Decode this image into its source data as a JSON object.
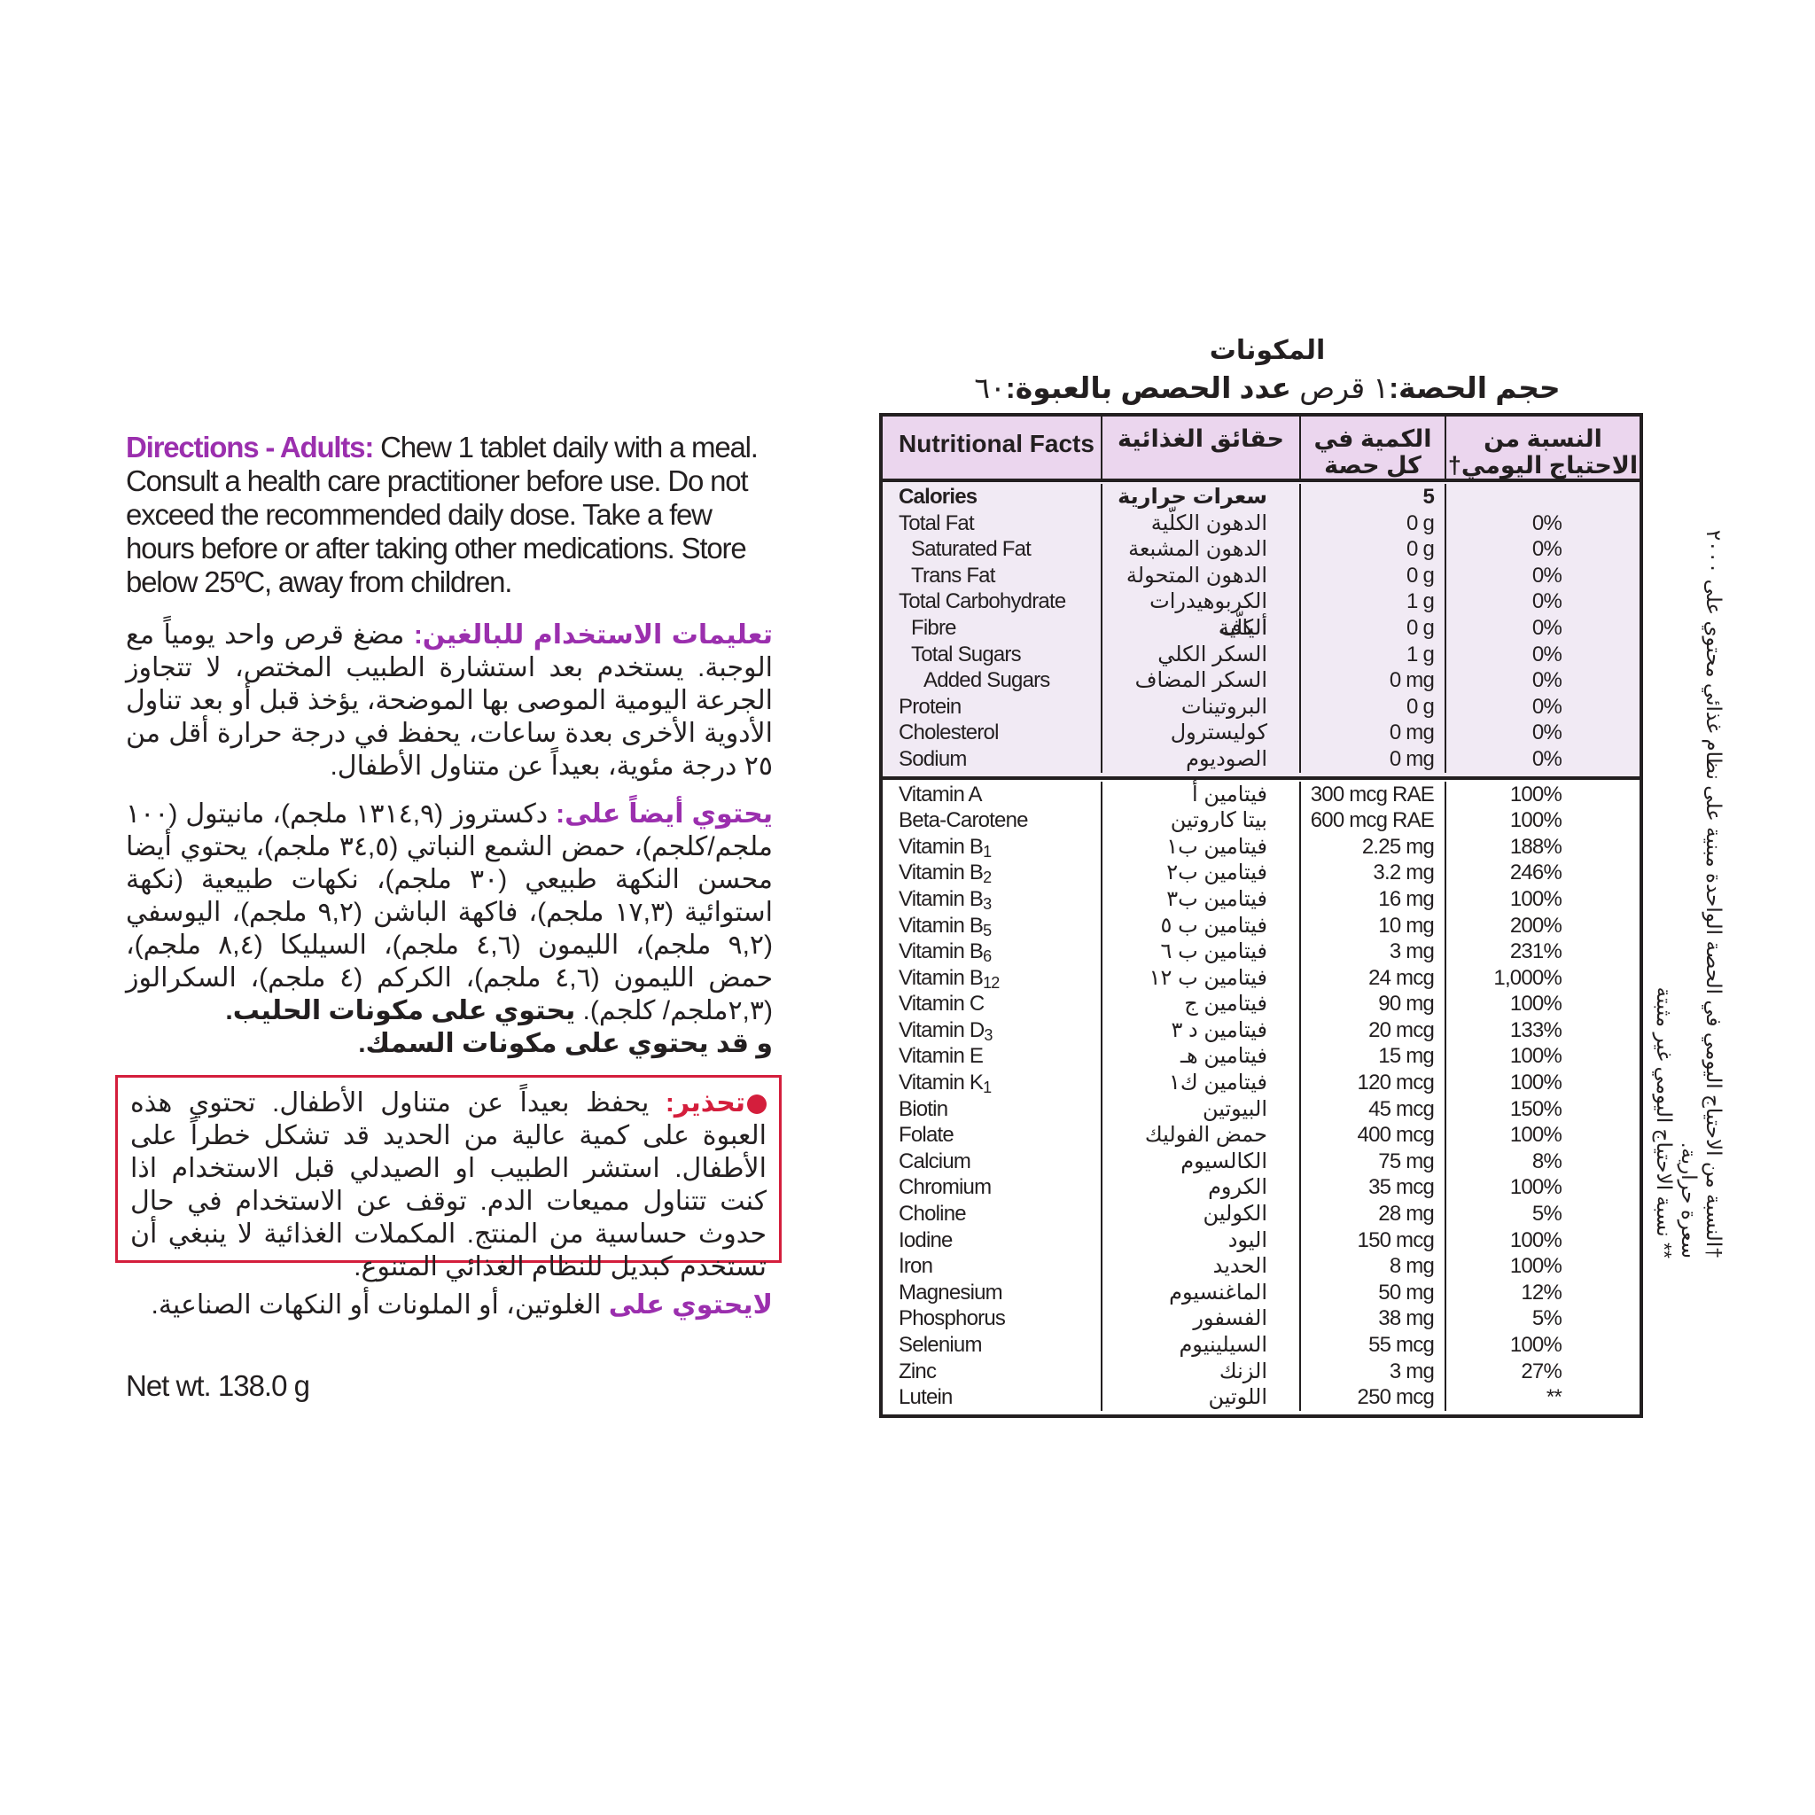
{
  "left": {
    "directions_en": {
      "label": "Directions - Adults:",
      "text": " Chew 1 tablet daily with a meal. Consult a health care practitioner before use. Do not exceed the recommended daily dose. Take a few hours before or after taking other medications. Store below 25ºC, away from children."
    },
    "directions_ar": {
      "label": "تعليمات الاستخدام للبالغين:",
      "text": " مضغ قرص واحد يومياً مع الوجبة. يستخدم بعد استشارة الطبيب المختص، لا تتجاوز الجرعة اليومية الموصى بها الموضحة، يؤخذ قبل أو بعد تناول الأدوية الأخرى بعدة ساعات، يحفظ في درجة حرارة أقل من ٢٥ درجة مئوية، بعيداً عن متناول الأطفال."
    },
    "also_contains_ar": {
      "label": "يحتوي أيضاً على:",
      "text": " دكستروز (١٣١٤,٩ ملجم)، مانيتول (١٠٠ ملجم/كلجم)، حمض الشمع النباتي (٣٤,٥ ملجم)، يحتوي أيضا محسن النكهة طبيعي (٣٠ ملجم)، نكهات طبيعية (نكهة استوائية (١٧,٣ ملجم)، فاكهة الباشن (٩,٢ ملجم)، اليوسفي (٩,٢ ملجم)، الليمون (٤,٦ ملجم)، السيليكا (٨,٤ ملجم)، حمض الليمون (٤,٦ ملجم)، الكركم (٤ ملجم)، السكرالوز (٢,٣ملجم/ كلجم). ",
      "milk": "يحتوي على مكونات الحليب.",
      "fish": "و قد يحتوي على مكونات السمك."
    },
    "warning_ar": {
      "icon": "stop-dot-icon",
      "label": "تحذير:",
      "text": " يحفظ بعيداً عن متناول الأطفال. تحتوي هذه العبوة على كمية عالية من الحديد قد تشكل خطراً على الأطفال. استشر الطبيب او الصيدلي قبل الاستخدام اذا كنت تتناول مميعات الدم. توقف عن الاستخدام في حال حدوث حساسية من المنتج. المكملات الغذائية لا ينبغي أن تستخدم كبديل للنظام الغذائي المتنوع."
    },
    "free_from_ar": {
      "label": "لايحتوي على",
      "text": " الغلوتين، أو الملونات أو النكهات الصناعية."
    },
    "net_wt": "Net wt. 138.0 g"
  },
  "colors": {
    "accent_purple": "#9b2fae",
    "warning_red": "#d41e3c",
    "header_bg": "#ebd6ee",
    "macro_bg": "#f1eaf4"
  },
  "titles": {
    "ingredients": "المكونات",
    "serving_size_label": "حجم الحصة:",
    "serving_size_value": "١ قرص",
    "servings_label": " عدد الحصص بالعبوة:",
    "servings_value": "٦٠"
  },
  "table": {
    "headers": {
      "en": "Nutritional Facts",
      "ar": "حقائق الغذائية",
      "amount": "الكمية في كل حصة",
      "dv": "النسبة من الاحتياج اليومي†"
    },
    "macros": [
      {
        "en": "Calories",
        "ar": "سعرات حرارية",
        "amount": "5",
        "dv": "",
        "bold": true,
        "indent": 0
      },
      {
        "en": "Total Fat",
        "ar": "الدهون الكلّية",
        "amount": "0 g",
        "dv": "0%",
        "indent": 0
      },
      {
        "en": "Saturated Fat",
        "ar": "الدهون المشبعة",
        "amount": "0 g",
        "dv": "0%",
        "indent": 1
      },
      {
        "en": "Trans Fat",
        "ar": "الدهون المتحولة",
        "amount": "0 g",
        "dv": "0%",
        "indent": 1
      },
      {
        "en": "Total Carbohydrate",
        "ar": "الكربوهيدرات الكلّية",
        "amount": "1 g",
        "dv": "0%",
        "indent": 0
      },
      {
        "en": "Fibre",
        "ar": "ألياف",
        "amount": "0 g",
        "dv": "0%",
        "indent": 1
      },
      {
        "en": "Total Sugars",
        "ar": "السكر الكلي",
        "amount": "1 g",
        "dv": "0%",
        "indent": 1
      },
      {
        "en": "Added Sugars",
        "ar": "السكر المضاف",
        "amount": "0 mg",
        "dv": "0%",
        "indent": 2
      },
      {
        "en": "Protein",
        "ar": "البروتينات",
        "amount": "0 g",
        "dv": "0%",
        "indent": 0
      },
      {
        "en": "Cholesterol",
        "ar": "كوليسترول",
        "amount": "0 mg",
        "dv": "0%",
        "indent": 0
      },
      {
        "en": "Sodium",
        "ar": "الصوديوم",
        "amount": "0 mg",
        "dv": "0%",
        "indent": 0
      }
    ],
    "micros": [
      {
        "en": "Vitamin A",
        "sub": "",
        "ar": "فيتامين أ",
        "amount": "300 mcg RAE",
        "dv": "100%"
      },
      {
        "en": "Beta-Carotene",
        "sub": "",
        "ar": "بيتا كاروتين",
        "amount": "600 mcg RAE",
        "dv": "100%"
      },
      {
        "en": "Vitamin B",
        "sub": "1",
        "ar": "فيتامين ب١",
        "amount": "2.25 mg",
        "dv": "188%"
      },
      {
        "en": "Vitamin B",
        "sub": "2",
        "ar": "فيتامين ب٢",
        "amount": "3.2 mg",
        "dv": "246%"
      },
      {
        "en": "Vitamin B",
        "sub": "3",
        "ar": "فيتامين ب٣",
        "amount": "16 mg",
        "dv": "100%"
      },
      {
        "en": "Vitamin B",
        "sub": "5",
        "ar": "فيتامين ب ٥",
        "amount": "10 mg",
        "dv": "200%"
      },
      {
        "en": "Vitamin B",
        "sub": "6",
        "ar": "فيتامين ب ٦",
        "amount": "3 mg",
        "dv": "231%"
      },
      {
        "en": "Vitamin B",
        "sub": "12",
        "ar": "فيتامين ب ١٢",
        "amount": "24 mcg",
        "dv": "1,000%"
      },
      {
        "en": "Vitamin C",
        "sub": "",
        "ar": "فيتامين ج",
        "amount": "90 mg",
        "dv": "100%"
      },
      {
        "en": "Vitamin D",
        "sub": "3",
        "ar": "فيتامين د ٣",
        "amount": "20 mcg",
        "dv": "133%"
      },
      {
        "en": "Vitamin E",
        "sub": "",
        "ar": "فيتامين هـ",
        "amount": "15 mg",
        "dv": "100%"
      },
      {
        "en": "Vitamin K",
        "sub": "1",
        "ar": "فيتامين ك١",
        "amount": "120 mcg",
        "dv": "100%"
      },
      {
        "en": "Biotin",
        "sub": "",
        "ar": "البيوتين",
        "amount": "45 mcg",
        "dv": "150%"
      },
      {
        "en": "Folate",
        "sub": "",
        "ar": "حمض الفوليك",
        "amount": "400 mcg",
        "dv": "100%"
      },
      {
        "en": "Calcium",
        "sub": "",
        "ar": "الكالسيوم",
        "amount": "75 mg",
        "dv": "8%"
      },
      {
        "en": "Chromium",
        "sub": "",
        "ar": "الكروم",
        "amount": "35 mcg",
        "dv": "100%"
      },
      {
        "en": "Choline",
        "sub": "",
        "ar": "الكولين",
        "amount": "28 mg",
        "dv": "5%"
      },
      {
        "en": "Iodine",
        "sub": "",
        "ar": "اليود",
        "amount": "150 mcg",
        "dv": "100%"
      },
      {
        "en": "Iron",
        "sub": "",
        "ar": "الحديد",
        "amount": "8 mg",
        "dv": "100%"
      },
      {
        "en": "Magnesium",
        "sub": "",
        "ar": "الماغنسيوم",
        "amount": "50 mg",
        "dv": "12%"
      },
      {
        "en": "Phosphorus",
        "sub": "",
        "ar": "الفسفور",
        "amount": "38 mg",
        "dv": "5%"
      },
      {
        "en": "Selenium",
        "sub": "",
        "ar": "السيلينيوم",
        "amount": "55 mcg",
        "dv": "100%"
      },
      {
        "en": "Zinc",
        "sub": "",
        "ar": "الزنك",
        "amount": "3 mg",
        "dv": "27%"
      },
      {
        "en": "Lutein",
        "sub": "",
        "ar": "اللوتين",
        "amount": "250 mcg",
        "dv": "**"
      }
    ]
  },
  "footnotes": {
    "dagger": "†النسبة من الاحتياج اليومي في الحصة الواحدة مبنية على نظام غذائي محتوي على ٢٠٠٠ سعرة حرارية.",
    "double_star": "** نسبة الاحتياج اليومي غير مثبتة"
  }
}
